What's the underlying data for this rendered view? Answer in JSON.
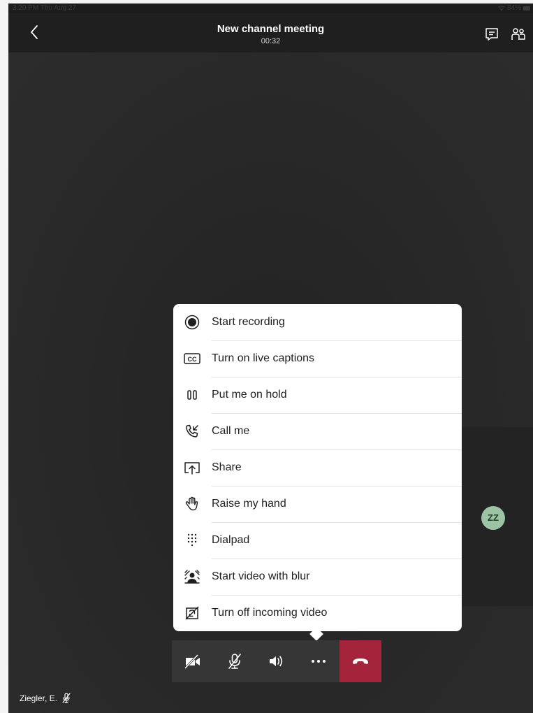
{
  "status_bar": {
    "time": "3:20 PM  Thu Aug 27",
    "battery": "84%"
  },
  "header": {
    "title": "New channel meeting",
    "timer": "00:32"
  },
  "menu": {
    "items": [
      {
        "label": "Start recording",
        "icon": "record-icon"
      },
      {
        "label": "Turn on live captions",
        "icon": "closed-captions-icon"
      },
      {
        "label": "Put me on hold",
        "icon": "pause-icon"
      },
      {
        "label": "Call me",
        "icon": "phone-incoming-icon"
      },
      {
        "label": "Share",
        "icon": "share-screen-icon"
      },
      {
        "label": "Raise my hand",
        "icon": "raise-hand-icon"
      },
      {
        "label": "Dialpad",
        "icon": "dialpad-icon"
      },
      {
        "label": "Start video with blur",
        "icon": "background-blur-icon"
      },
      {
        "label": "Turn off incoming video",
        "icon": "video-off-icon"
      }
    ]
  },
  "participant": {
    "initials": "ZZ",
    "name": "Ziegler, E."
  },
  "controls": [
    "camera-off-icon",
    "mic-muted-icon",
    "speaker-icon",
    "more-icon",
    "hang-up-icon"
  ],
  "colors": {
    "hangup": "#a4253b",
    "avatar_bg": "#9cc4a4",
    "menu_bg": "#ffffff"
  }
}
